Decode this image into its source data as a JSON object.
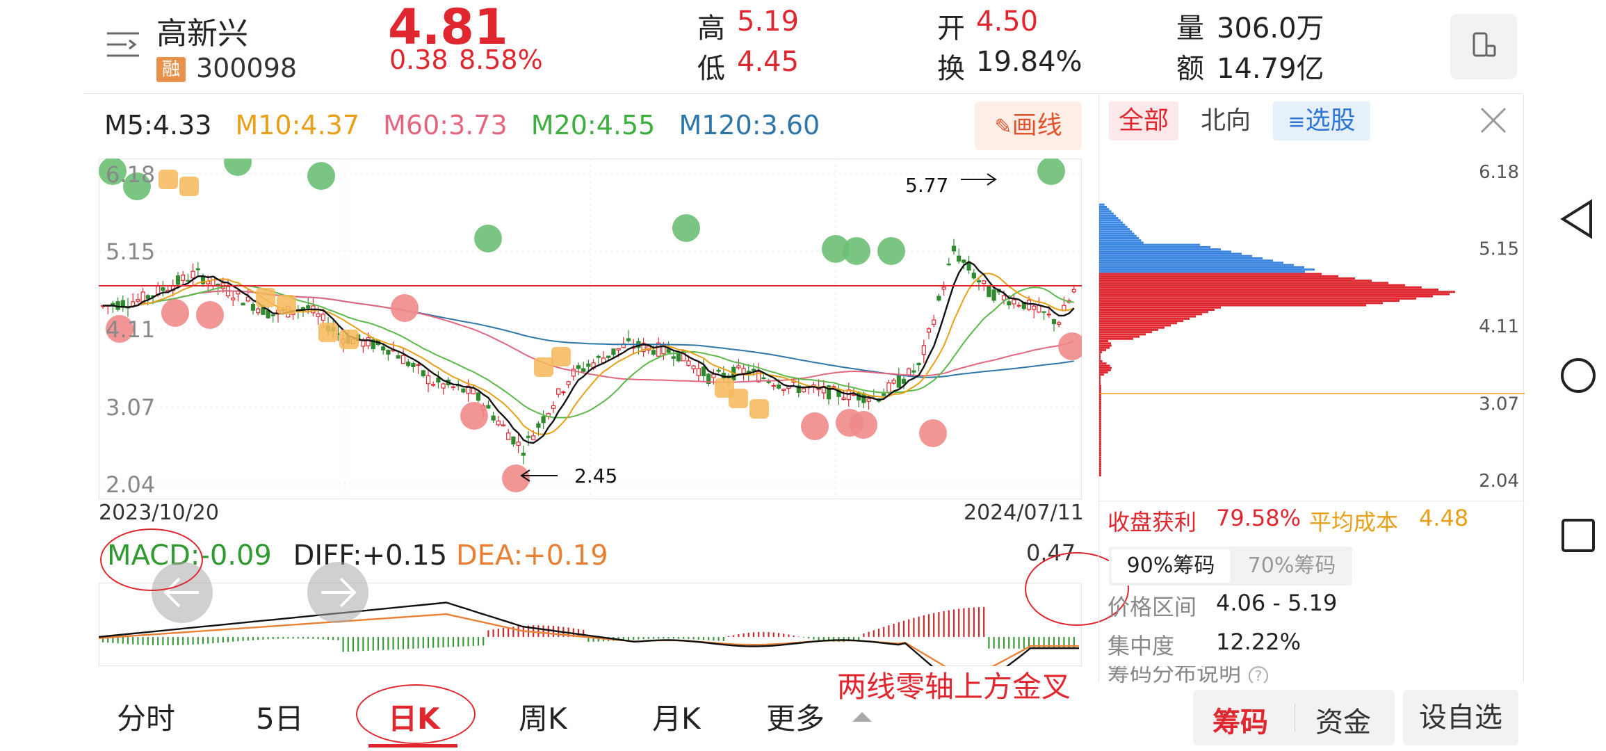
{
  "header": {
    "stock_name": "高新兴",
    "rong_badge": "融",
    "stock_code": "300098",
    "price": "4.81",
    "change": "0.38",
    "change_pct": "8.58%",
    "high_label": "高",
    "high_value": "5.19",
    "low_label": "低",
    "low_value": "4.45",
    "open_label": "开",
    "open_value": "4.50",
    "turnover_label": "换",
    "turnover_value": "19.84%",
    "volume_label": "量",
    "volume_value": "306.0万",
    "amount_label": "额",
    "amount_value": "14.79亿"
  },
  "ma_bar": {
    "m5": "M5:4.33",
    "m10": "M10:4.37",
    "m60": "M60:3.73",
    "m20": "M20:4.55",
    "m120": "M120:3.60",
    "draw_button": "画线"
  },
  "kline": {
    "y_ticks": [
      "6.18",
      "5.15",
      "4.11",
      "3.07",
      "2.04"
    ],
    "start_date": "2023/10/20",
    "end_date": "2024/07/11",
    "high_annotation": "5.77",
    "low_annotation": "2.45"
  },
  "macd_bar": {
    "macd": "MACD:-0.09",
    "diff": "DIFF:+0.15",
    "dea": "DEA:+0.19",
    "max_value": "0.47",
    "annotation": "两线零轴上方金叉"
  },
  "chip_panel": {
    "tabs": [
      "全部",
      "北向",
      "选股"
    ],
    "y_ticks": [
      "6.18",
      "5.15",
      "4.11",
      "3.07",
      "2.04"
    ],
    "profit_label": "收盘获利",
    "profit_value": "79.58%",
    "avg_cost_label": "平均成本",
    "avg_cost_value": "4.48",
    "sub_tabs": [
      "90%筹码",
      "70%筹码"
    ],
    "price_range_label": "价格区间",
    "price_range_value": "4.06 - 5.19",
    "concentration_label": "集中度",
    "concentration_value": "12.22%",
    "explain_label": "筹码分布说明"
  },
  "bottom_tabs": [
    "分时",
    "5日",
    "日K",
    "周K",
    "月K",
    "更多"
  ],
  "bottom_right": {
    "chips": "筹码",
    "funds": "资金",
    "add_watch": "设自选"
  },
  "colors": {
    "up": "#e0272f",
    "down": "#2f8a2f",
    "m5": "#111111",
    "m10": "#e8a019",
    "m60": "#e2667e",
    "m20": "#5cb94a",
    "m120": "#2e75a8",
    "chip_profit": "#3a86e0",
    "chip_loss": "#e0272f"
  }
}
